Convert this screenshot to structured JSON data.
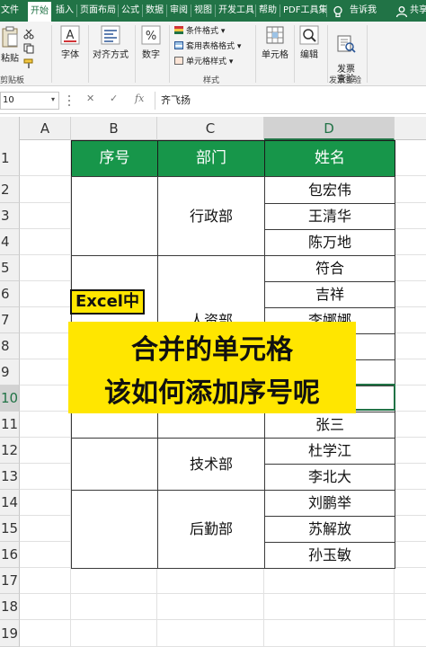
{
  "ribbon_tabs": [
    "文件",
    "开始",
    "插入",
    "页面布局",
    "公式",
    "数据",
    "审阅",
    "视图",
    "开发工具",
    "帮助",
    "PDF工具集"
  ],
  "active_tab": "开始",
  "tell_me": "告诉我",
  "share": "共享",
  "ribbon": {
    "paste": "粘贴",
    "clipboard_group": "剪贴板",
    "font": "字体",
    "alignment": "对齐方式",
    "number": "数字",
    "conditional_format": "条件格式",
    "table_format": "套用表格格式",
    "cell_style": "单元格样式",
    "styles_group": "样式",
    "cells": "单元格",
    "editing": "编辑",
    "invoice_check_btn": "发票\n查验",
    "invoice_check_group": "发票查验"
  },
  "formula_bar": {
    "name_box": "10",
    "fx": "fx",
    "content": "齐飞扬"
  },
  "grid": {
    "columns": [
      "A",
      "B",
      "C",
      "D"
    ],
    "selected_column": "D",
    "rows": [
      "1",
      "2",
      "3",
      "4",
      "5",
      "6",
      "7",
      "8",
      "9",
      "10",
      "11",
      "12",
      "13",
      "14",
      "15",
      "16",
      "17",
      "18",
      "19"
    ],
    "selected_row": "10"
  },
  "table": {
    "headers": [
      "序号",
      "部门",
      "姓名"
    ],
    "departments": [
      "行政部",
      "人资部",
      "技术部",
      "后勤部"
    ],
    "names": [
      "包宏伟",
      "王清华",
      "陈万地",
      "符合",
      "吉祥",
      "李娜娜",
      "",
      "",
      "",
      "张三",
      "杜学江",
      "李北大",
      "刘鹏举",
      "苏解放",
      "孙玉敏"
    ]
  },
  "overlay": {
    "tag": "Excel中",
    "line1": "合并的单元格",
    "line2": "该如何添加序号呢"
  },
  "colors": {
    "excel_green": "#217346",
    "header_green": "#17964a",
    "highlight_yellow": "#ffe600"
  }
}
